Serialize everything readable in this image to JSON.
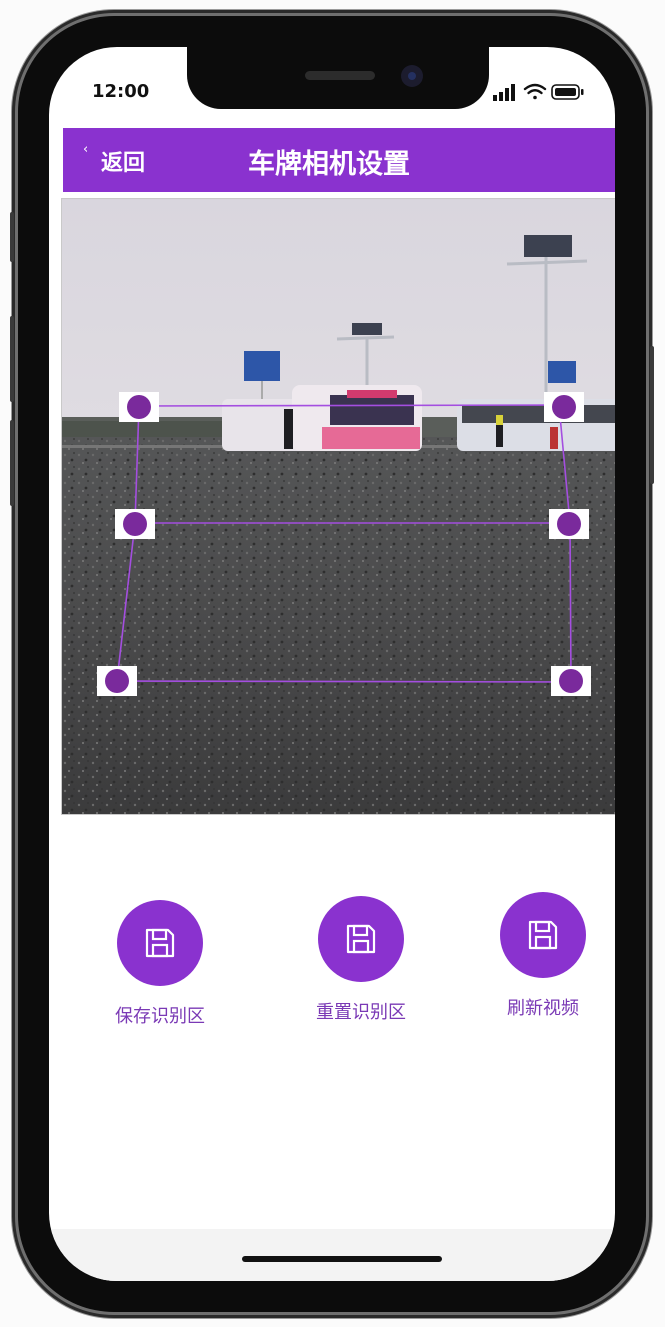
{
  "status": {
    "time": "12:00"
  },
  "header": {
    "back_label": "返回",
    "title": "车牌相机设置",
    "color": "#8a32cf"
  },
  "actions": [
    {
      "label": "保存识别区",
      "icon": "floppy-disk-icon"
    },
    {
      "label": "重置识别区",
      "icon": "floppy-disk-icon"
    },
    {
      "label": "刷新视频",
      "icon": "floppy-disk-icon"
    }
  ],
  "colors": {
    "accent": "#8a32cf",
    "handle": "#7a2a9c",
    "label": "#7a39b5"
  }
}
